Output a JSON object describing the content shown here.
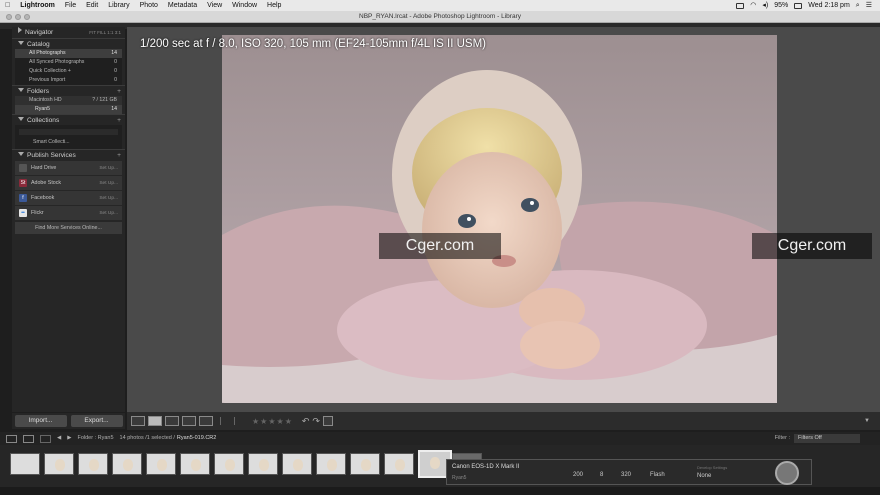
{
  "menubar": {
    "app": "Lightroom",
    "items": [
      "File",
      "Edit",
      "Library",
      "Photo",
      "Metadata",
      "View",
      "Window",
      "Help"
    ],
    "battery": "95%",
    "clock": "Wed 2:18 pm"
  },
  "window": {
    "title": "NBP_RYAN.lrcat - Adobe Photoshop Lightroom - Library"
  },
  "navigator": {
    "label": "Navigator",
    "options": "FIT  FILL  1:1  3:1"
  },
  "catalog": {
    "label": "Catalog",
    "rows": [
      {
        "name": "All Photographs",
        "count": "14"
      },
      {
        "name": "All Synced Photographs",
        "count": "0"
      },
      {
        "name": "Quick Collection +",
        "count": "0"
      },
      {
        "name": "Previous Import",
        "count": "0"
      }
    ]
  },
  "folders": {
    "label": "Folders",
    "volume": {
      "name": "Macintosh HD",
      "space": "? / 121 GB"
    },
    "folder": {
      "name": "Ryan5",
      "count": "14"
    }
  },
  "collections": {
    "label": "Collections",
    "smart": "Smart Collecti..."
  },
  "publish": {
    "label": "Publish Services",
    "services": [
      {
        "name": "Hard Drive",
        "setup": "Set Up...",
        "color": "#555555",
        "glyph": ""
      },
      {
        "name": "Adobe Stock",
        "setup": "Set Up...",
        "color": "#8a2a3a",
        "glyph": "St"
      },
      {
        "name": "Facebook",
        "setup": "Set Up...",
        "color": "#3b5998",
        "glyph": "f"
      },
      {
        "name": "Flickr",
        "setup": "Set Up...",
        "color": "#e6e6e6",
        "glyph": "••"
      }
    ],
    "find_more": "Find More Services Online..."
  },
  "buttons": {
    "import": "Import...",
    "export": "Export..."
  },
  "photo_info": "1/200 sec at f / 8.0, ISO 320, 105 mm (EF24-105mm f/4L IS II USM)",
  "watermark": "Cger.com",
  "filmstrip": {
    "folder": "Folder : Ryan5",
    "summary": "14 photos /1 selected /",
    "filename": "Ryan5-019.CR2",
    "filter_label": "Filter :",
    "filter_value": "Filters Off",
    "thumb_count": 14,
    "selected_index": 12
  },
  "camera": {
    "model": "Canon EOS-1D X Mark II",
    "folder": "Ryan5",
    "shutter": "200",
    "aperture": "8",
    "iso": "320",
    "wb": "Flash",
    "develop_settings_label": "Develop Settings",
    "develop_settings": "None"
  }
}
